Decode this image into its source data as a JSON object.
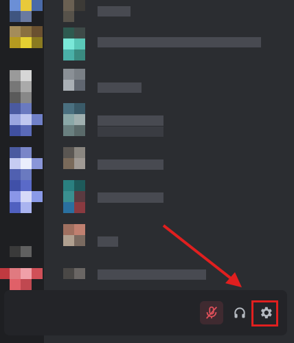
{
  "user_controls": {
    "mute_icon": "mic-muted-icon",
    "deafen_icon": "headphones-icon",
    "settings_icon": "gear-icon"
  },
  "colors": {
    "background": "#2b2d31",
    "rail": "#1e1f22",
    "user_panel": "#232428",
    "muted_red": "#e0505a",
    "icon_gray": "#b5bac1",
    "annotation_red": "#e01f1f"
  },
  "annotations": {
    "highlight_target": "settings-button",
    "arrow_points_to": "settings-button"
  }
}
